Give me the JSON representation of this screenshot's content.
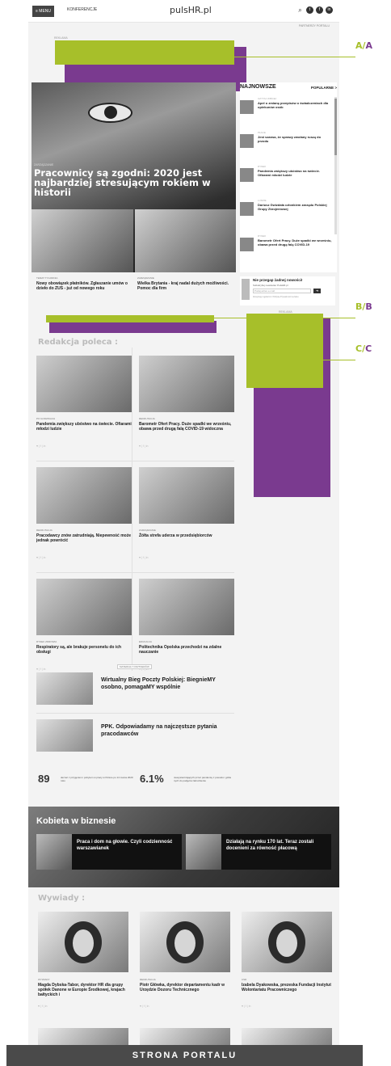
{
  "header": {
    "menu_label": "≡ MENU",
    "conferences_label": "KONFERENCJE",
    "logo": "pulsHR.pl",
    "portal_partners": "PARTNERZY PORTALU"
  },
  "ad_label": "REKLAMA",
  "annotations": {
    "a_prefix": "A/",
    "a_suffix": "A",
    "b_prefix": "B/",
    "b_suffix": "B",
    "c_prefix": "C/",
    "c_suffix": "C"
  },
  "hero": {
    "kicker": "ZARZĄDZANIE",
    "title": "Pracownicy są zgodni: 2020 jest najbardziej stresującym rokiem w historii"
  },
  "sidebar": {
    "tab_latest": "NAJNOWSZE",
    "tab_popular": "POPULARNE >",
    "items": [
      {
        "kicker": "CZYTAJ WIĘCEJ",
        "title": "Apel o zmianę przepisów o świadczeniach dla opiekunów osób"
      },
      {
        "kicker": "PŁACE",
        "title": "Jest szansa, że sprawy zwołany ruszą do przodu"
      },
      {
        "kicker": "RYNEK",
        "title": "Pandemia zwiększy ubóstwo na świecie. Ofiarami młodzi ludzie"
      },
      {
        "kicker": "LUDZIE",
        "title": "Dariusz Gwizdała członkiem zarządu Polskiej Grupy Zbrojeniowej"
      },
      {
        "kicker": "RYNEK",
        "title": "Barometr Ofert Pracy. Duże spadki we wrześniu, obawa przed drugą falą COVID-19"
      }
    ]
  },
  "mini_news": [
    {
      "kicker": "TEMAT TYGODNIA",
      "title": "Nowy obowiązek płatników. Zgłaszanie umów o dzieło do ZUS - już od nowego roku"
    },
    {
      "kicker": "ZARZĄDZANIE",
      "title": "Wielka Brytania - kraj nadal dużych możliwości. Pomoc dla firm"
    }
  ],
  "newsletter": {
    "title": "Nie przegap żadnej nowości!",
    "desc": "Subskrybuj newsletter PulsHR.pl",
    "placeholder": "Podaj adres e-mail",
    "button": "➜",
    "footnote": "Akceptuję regulamin i Politykę Prywatności serwisu"
  },
  "recommended": {
    "title": "Redakcja poleca :",
    "cards": [
      {
        "kicker": "PO GODZINACH",
        "title": "Pandemia zwiększy ubóstwo na świecie. Ofiarami młodzi ludzie",
        "share": "♥ | f | in"
      },
      {
        "kicker": "REKRUTACJA",
        "title": "Barometr Ofert Pracy. Duże spadki we wrześniu, obawa przed drugą falą COVID-19 widoczna",
        "share": "♥ | f | in"
      },
      {
        "kicker": "REKRUTACJA",
        "title": "Pracodawcy znów zatrudniają. Niepewność może jednak powrócić",
        "share": "♥ | f | in"
      },
      {
        "kicker": "ZARZĄDZANIE",
        "title": "Żółta strefa uderza w przedsiębiorców",
        "share": "♥ | f | in"
      },
      {
        "kicker": "RYNEK ZDROWIA",
        "title": "Respiratory są, ale brakuje personelu do ich obsługi",
        "share": "♥ | f | in"
      },
      {
        "kicker": "EDUKACJA",
        "title": "Politechnika Opolska przechodzi na zdalne nauczanie",
        "share": "♥ | f | in"
      }
    ]
  },
  "partner": {
    "label": "MATERIAŁY PARTNERÓW",
    "items": [
      {
        "title": "Wirtualny Bieg Poczty Polskiej: BiegnieMY osobno, pomagaMY wspólnie"
      },
      {
        "title": "PPK. Odpowiadamy na najczęstsze pytania pracodawców"
      }
    ]
  },
  "stats": [
    {
      "number": "89",
      "text": "derzeń z przyjęciem i pobytem w pracy w Polsce po 14 marca 2020 roku"
    },
    {
      "number": "6.1%",
      "text": "niewystarczających przez pandemię z powodu i gdzie nych do podjęcia zatrudnienia"
    }
  ],
  "kobieta": {
    "title": "Kobieta w biznesie",
    "items": [
      {
        "title": "Praca i dom na głowie. Czyli codzienność warszawianek"
      },
      {
        "title": "Działają na rynku 170 lat. Teraz zostali docenieni za równość płacową"
      }
    ]
  },
  "interviews": {
    "title": "Wywiady :",
    "cards": [
      {
        "kicker": "WYWIADY",
        "title": "Magda Dybska-Tabor, dyrektor HR dla grupy spółek Danone w Europie Środkowej, krajach bałtyckich i",
        "share": "♥ | f | in"
      },
      {
        "kicker": "REKRUTACJA",
        "title": "Piotr Główka, dyrektor departamentu kadr w Urzędzie Dozoru Technicznego",
        "share": "♥ | f | in"
      },
      {
        "kicker": "CSR",
        "title": "Izabela Dyakowska, prezeska Fundacji Instytut Wolontariatu Pracowniczego",
        "share": "♥ | f | in"
      }
    ]
  },
  "footer_label": "STRONA PORTALU",
  "colors": {
    "green": "#a7bf2a",
    "purple": "#7a3a8f"
  }
}
